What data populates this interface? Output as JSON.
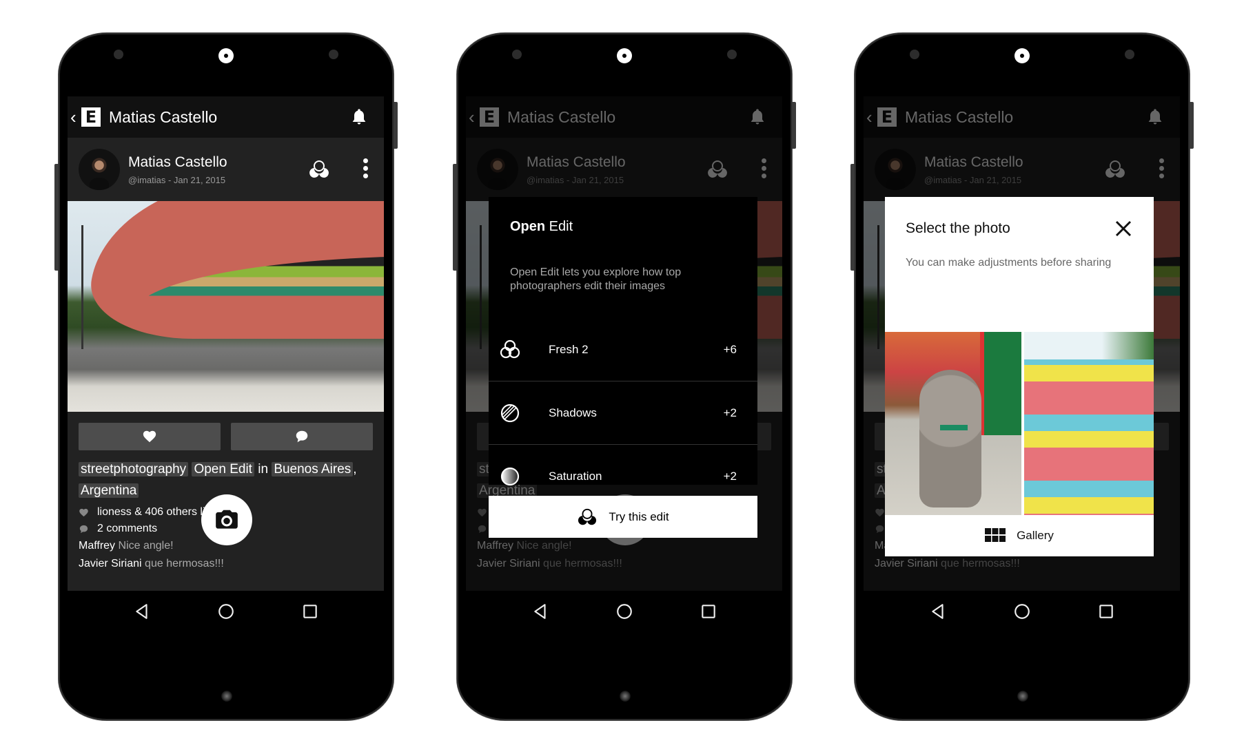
{
  "app": {
    "back_glyph": "‹",
    "logo_letter": "E",
    "header_title": "Matias Castello"
  },
  "post": {
    "author": "Matias Castello",
    "subtitle": "@imatias - Jan 21, 2015",
    "tags": [
      "streetphotography",
      "Open Edit"
    ],
    "location_joiner": "in",
    "location_city": "Buenos Aires",
    "location_sep": ",",
    "location_country": "Argentina",
    "likes_text": "lioness & 406 others like this.",
    "comments_count_text": "2 comments",
    "comments": [
      {
        "author": "Maffrey",
        "text": "Nice angle!"
      },
      {
        "author": "Javier Siriani",
        "text": "que hermosas!!!"
      }
    ]
  },
  "icons": {
    "back": "chevron-left-icon",
    "bell": "bell-icon",
    "edit": "open-edit-icon",
    "more": "more-vert-icon",
    "like": "heart-icon",
    "comment": "speech-bubble-icon",
    "camera": "camera-icon",
    "nav_back": "triangle-back-icon",
    "nav_home": "circle-home-icon",
    "nav_recents": "square-recents-icon"
  },
  "open_edit_dialog": {
    "title_bold": "Open",
    "title_rest": " Edit",
    "description": "Open Edit lets you explore how top photographers edit their images",
    "items": [
      {
        "label": "Fresh 2",
        "value": "+6",
        "icon": "filter-circles-icon"
      },
      {
        "label": "Shadows",
        "value": "+2",
        "icon": "shadows-icon"
      },
      {
        "label": "Saturation",
        "value": "+2",
        "icon": "saturation-icon"
      }
    ],
    "action_label": "Try this edit"
  },
  "select_photo_dialog": {
    "title": "Select the photo",
    "subtitle": "You can make adjustments before sharing",
    "photos": [
      "poodle-photo",
      "stadium-seats-photo"
    ],
    "gallery_label": "Gallery"
  },
  "colors": {
    "screen_bg": "#222222",
    "appbar_bg": "#111111",
    "button_bg": "#4d4d4d",
    "tag_bg": "#444444"
  }
}
